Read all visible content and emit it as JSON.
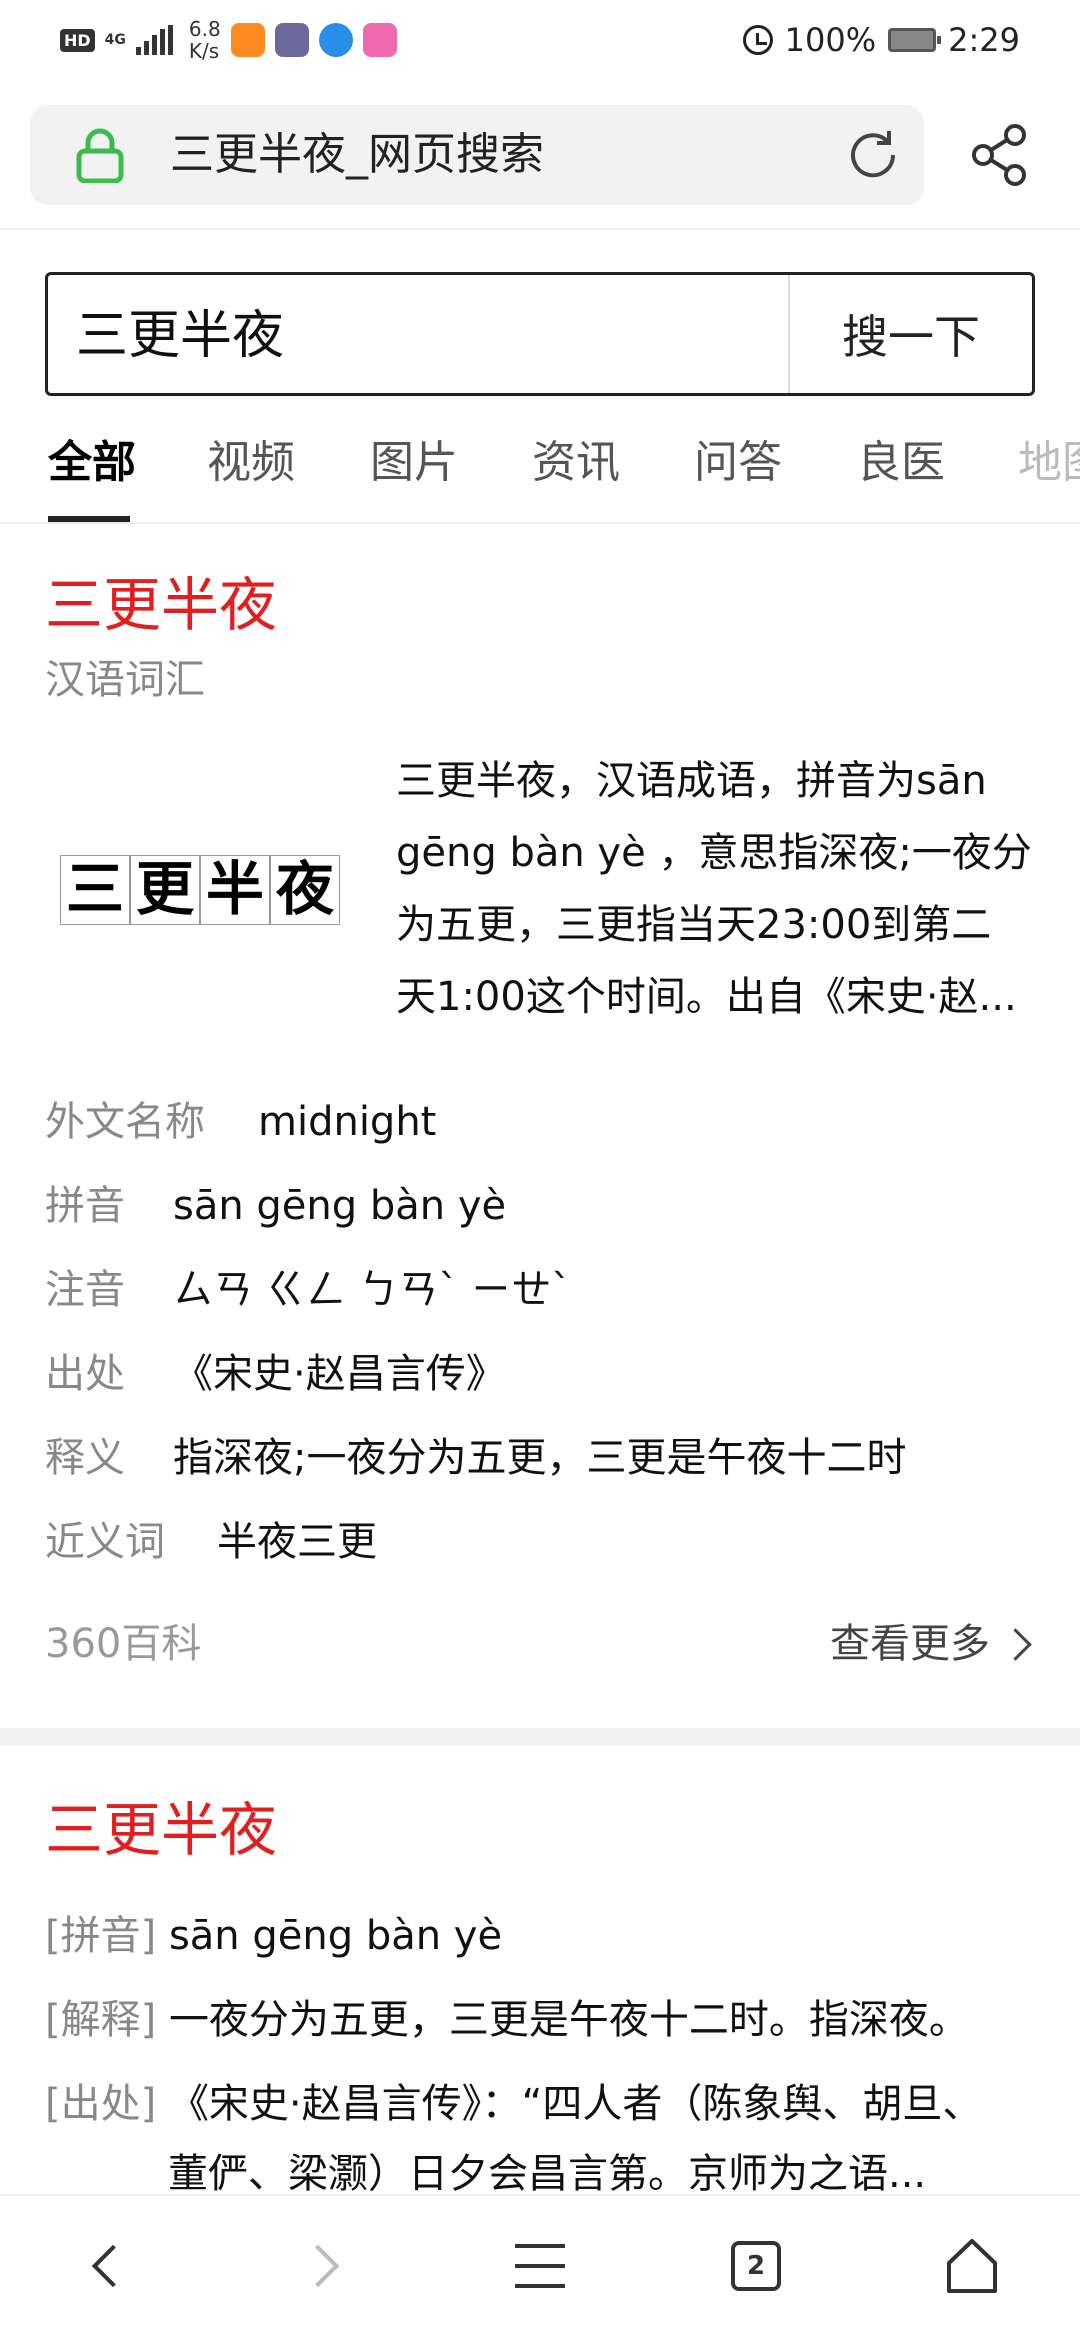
{
  "status_bar": {
    "hd": "HD",
    "network": "4G",
    "speed_value": "6.8",
    "speed_unit": "K/s",
    "battery": "100%",
    "time": "2:29"
  },
  "url_bar": {
    "title": "三更半夜_网页搜索"
  },
  "search": {
    "query": "三更半夜",
    "button_label": "搜一下"
  },
  "tabs": [
    {
      "label": "全部"
    },
    {
      "label": "视频"
    },
    {
      "label": "图片"
    },
    {
      "label": "资讯"
    },
    {
      "label": "问答"
    },
    {
      "label": "良医"
    },
    {
      "label": "地图"
    }
  ],
  "card1": {
    "title": "三更半夜",
    "subtitle": "汉语词汇",
    "image_chars": [
      "三",
      "更",
      "半",
      "夜"
    ],
    "description_lines": [
      "三更半夜，汉语成语，拼音为sān",
      "gēng bàn yè ，意思指深夜;一夜分",
      "为五更，三更指当天23:00到第二",
      "天1:00这个时间。出自《宋史·赵..."
    ],
    "info": [
      {
        "label": "外文名称",
        "value": "midnight"
      },
      {
        "label": "拼音",
        "value": "sān gēng bàn yè"
      },
      {
        "label": "注音",
        "value": "ㄙㄢ ㄍㄥ ㄅㄢˋ ㄧㄝˋ"
      },
      {
        "label": "出处",
        "value": "《宋史·赵昌言传》"
      },
      {
        "label": "释义",
        "value": "指深夜;一夜分为五更，三更是午夜十二时"
      },
      {
        "label": "近义词",
        "value": "半夜三更"
      }
    ],
    "source": "360百科",
    "more": "查看更多"
  },
  "card2": {
    "title": "三更半夜",
    "rows": [
      {
        "label": "[拼音]",
        "value": "sān gēng bàn yè"
      },
      {
        "label": "[解释]",
        "value": "一夜分为五更，三更是午夜十二时。指深夜。"
      },
      {
        "label": "[出处]",
        "value": "《宋史·赵昌言传》：“四人者（陈象舆、胡旦、",
        "cont": "董俨、梁灏）日夕会昌言第。京师为之语..."
      }
    ]
  },
  "bottom_nav": {
    "tab_count": "2"
  },
  "colors": {
    "accent_red": "#e02020",
    "lock_green": "#3dbb4e",
    "label_gray": "#888888"
  },
  "icons": [
    "lock-icon",
    "reload-icon",
    "share-icon",
    "alarm-icon",
    "battery-icon",
    "back-icon",
    "forward-icon",
    "menu-icon",
    "tabs-icon",
    "home-icon",
    "chevron-right-icon"
  ]
}
